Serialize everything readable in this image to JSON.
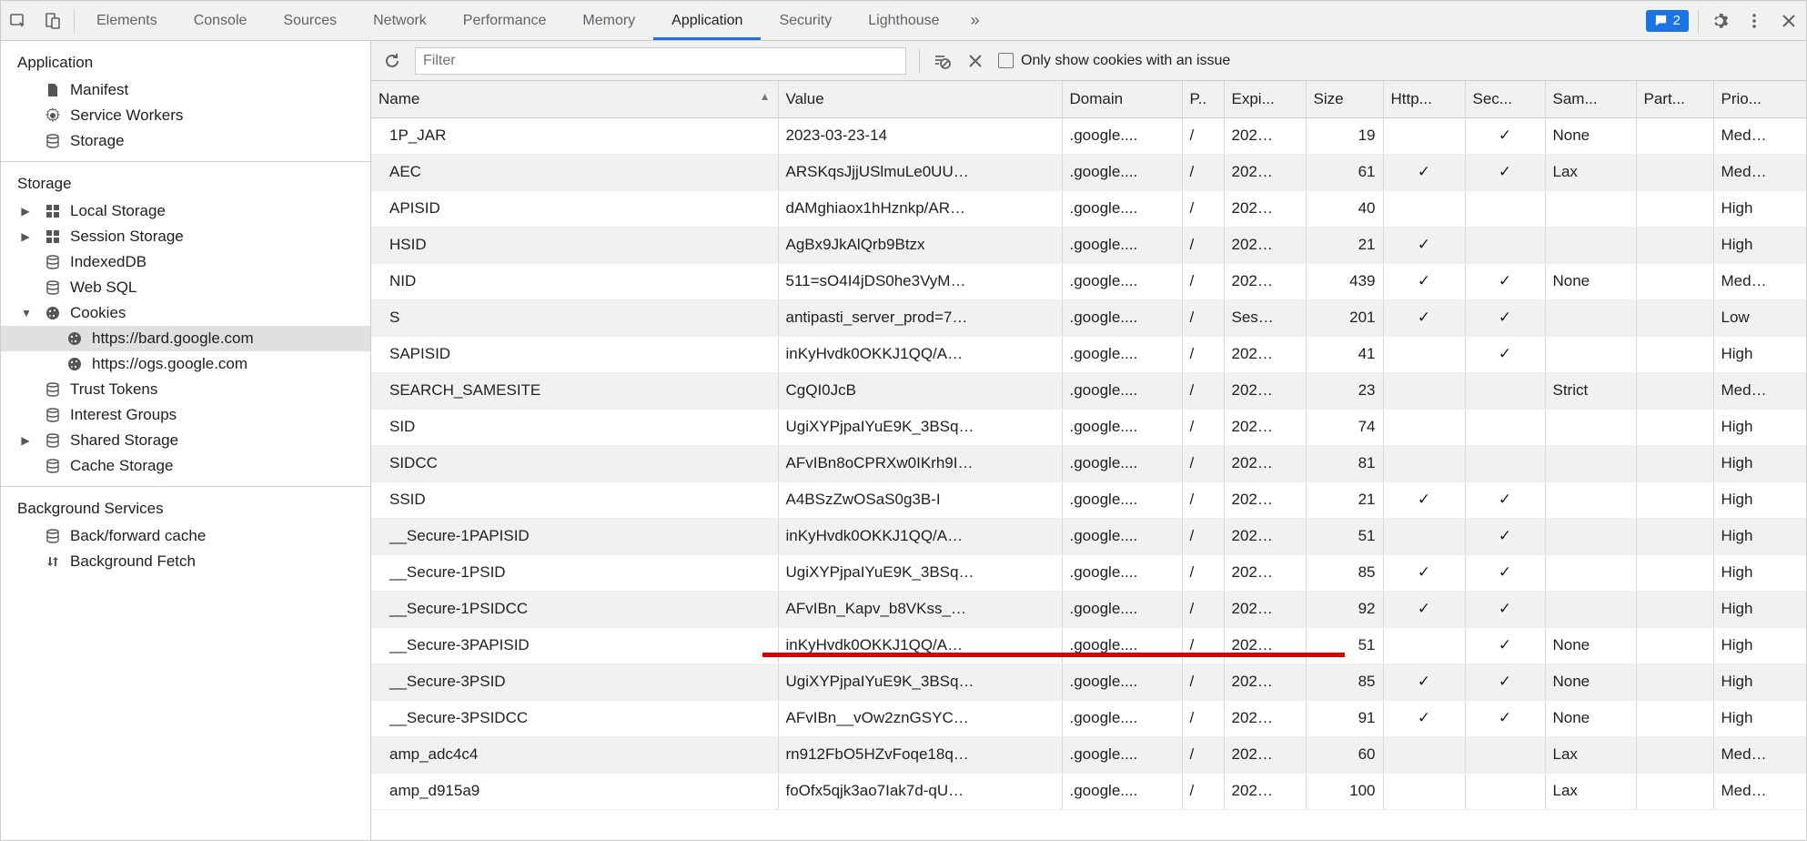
{
  "tabbar": {
    "tabs": [
      "Elements",
      "Console",
      "Sources",
      "Network",
      "Performance",
      "Memory",
      "Application",
      "Security",
      "Lighthouse"
    ],
    "active": "Application",
    "issues_count": "2"
  },
  "sidebar": {
    "section_application": {
      "title": "Application",
      "items": [
        {
          "icon": "file",
          "label": "Manifest"
        },
        {
          "icon": "gear",
          "label": "Service Workers"
        },
        {
          "icon": "db",
          "label": "Storage"
        }
      ]
    },
    "section_storage": {
      "title": "Storage",
      "items": [
        {
          "tri": "right",
          "icon": "grid",
          "label": "Local Storage"
        },
        {
          "tri": "right",
          "icon": "grid",
          "label": "Session Storage"
        },
        {
          "tri": "",
          "icon": "db",
          "label": "IndexedDB"
        },
        {
          "tri": "",
          "icon": "db",
          "label": "Web SQL"
        },
        {
          "tri": "down",
          "icon": "cookie",
          "label": "Cookies"
        },
        {
          "tri": "",
          "icon": "cookie",
          "label": "https://bard.google.com",
          "indent": 2,
          "selected": true
        },
        {
          "tri": "",
          "icon": "cookie",
          "label": "https://ogs.google.com",
          "indent": 2
        },
        {
          "tri": "",
          "icon": "db",
          "label": "Trust Tokens"
        },
        {
          "tri": "",
          "icon": "db",
          "label": "Interest Groups"
        },
        {
          "tri": "right",
          "icon": "db",
          "label": "Shared Storage"
        },
        {
          "tri": "",
          "icon": "db",
          "label": "Cache Storage"
        }
      ]
    },
    "section_bg": {
      "title": "Background Services",
      "items": [
        {
          "icon": "db",
          "label": "Back/forward cache"
        },
        {
          "icon": "swap",
          "label": "Background Fetch"
        }
      ]
    }
  },
  "toolbar": {
    "filter_placeholder": "Filter",
    "only_issues_label": "Only show cookies with an issue"
  },
  "table": {
    "headers": [
      "Name",
      "Value",
      "Domain",
      "P..",
      "Expi...",
      "Size",
      "Http...",
      "Sec...",
      "Sam...",
      "Part...",
      "Prio..."
    ],
    "sort_col": 0,
    "rows": [
      {
        "name": "1P_JAR",
        "value": "2023-03-23-14",
        "domain": ".google....",
        "path": "/",
        "expires": "202…",
        "size": "19",
        "http": "",
        "sec": "✓",
        "same": "None",
        "part": "",
        "prio": "Med…"
      },
      {
        "name": "AEC",
        "value": "ARSKqsJjjUSlmuLe0UU…",
        "domain": ".google....",
        "path": "/",
        "expires": "202…",
        "size": "61",
        "http": "✓",
        "sec": "✓",
        "same": "Lax",
        "part": "",
        "prio": "Med…"
      },
      {
        "name": "APISID",
        "value": "dAMghiaox1hHznkp/AR…",
        "domain": ".google....",
        "path": "/",
        "expires": "202…",
        "size": "40",
        "http": "",
        "sec": "",
        "same": "",
        "part": "",
        "prio": "High"
      },
      {
        "name": "HSID",
        "value": "AgBx9JkAlQrb9Btzx",
        "domain": ".google....",
        "path": "/",
        "expires": "202…",
        "size": "21",
        "http": "✓",
        "sec": "",
        "same": "",
        "part": "",
        "prio": "High"
      },
      {
        "name": "NID",
        "value": "511=sO4I4jDS0he3VyM…",
        "domain": ".google....",
        "path": "/",
        "expires": "202…",
        "size": "439",
        "http": "✓",
        "sec": "✓",
        "same": "None",
        "part": "",
        "prio": "Med…"
      },
      {
        "name": "S",
        "value": "antipasti_server_prod=7…",
        "domain": ".google....",
        "path": "/",
        "expires": "Ses…",
        "size": "201",
        "http": "✓",
        "sec": "✓",
        "same": "",
        "part": "",
        "prio": "Low"
      },
      {
        "name": "SAPISID",
        "value": "inKyHvdk0OKKJ1QQ/A…",
        "domain": ".google....",
        "path": "/",
        "expires": "202…",
        "size": "41",
        "http": "",
        "sec": "✓",
        "same": "",
        "part": "",
        "prio": "High"
      },
      {
        "name": "SEARCH_SAMESITE",
        "value": "CgQI0JcB",
        "domain": ".google....",
        "path": "/",
        "expires": "202…",
        "size": "23",
        "http": "",
        "sec": "",
        "same": "Strict",
        "part": "",
        "prio": "Med…"
      },
      {
        "name": "SID",
        "value": "UgiXYPjpaIYuE9K_3BSq…",
        "domain": ".google....",
        "path": "/",
        "expires": "202…",
        "size": "74",
        "http": "",
        "sec": "",
        "same": "",
        "part": "",
        "prio": "High"
      },
      {
        "name": "SIDCC",
        "value": "AFvIBn8oCPRXw0IKrh9I…",
        "domain": ".google....",
        "path": "/",
        "expires": "202…",
        "size": "81",
        "http": "",
        "sec": "",
        "same": "",
        "part": "",
        "prio": "High"
      },
      {
        "name": "SSID",
        "value": "A4BSzZwOSaS0g3B-I",
        "domain": ".google....",
        "path": "/",
        "expires": "202…",
        "size": "21",
        "http": "✓",
        "sec": "✓",
        "same": "",
        "part": "",
        "prio": "High"
      },
      {
        "name": "__Secure-1PAPISID",
        "value": "inKyHvdk0OKKJ1QQ/A…",
        "domain": ".google....",
        "path": "/",
        "expires": "202…",
        "size": "51",
        "http": "",
        "sec": "✓",
        "same": "",
        "part": "",
        "prio": "High"
      },
      {
        "name": "__Secure-1PSID",
        "value": "UgiXYPjpaIYuE9K_3BSq…",
        "domain": ".google....",
        "path": "/",
        "expires": "202…",
        "size": "85",
        "http": "✓",
        "sec": "✓",
        "same": "",
        "part": "",
        "prio": "High"
      },
      {
        "name": "__Secure-1PSIDCC",
        "value": "AFvIBn_Kapv_b8VKss_…",
        "domain": ".google....",
        "path": "/",
        "expires": "202…",
        "size": "92",
        "http": "✓",
        "sec": "✓",
        "same": "",
        "part": "",
        "prio": "High"
      },
      {
        "name": "__Secure-3PAPISID",
        "value": "inKyHvdk0OKKJ1QQ/A…",
        "domain": ".google....",
        "path": "/",
        "expires": "202…",
        "size": "51",
        "http": "",
        "sec": "✓",
        "same": "None",
        "part": "",
        "prio": "High"
      },
      {
        "name": "__Secure-3PSID",
        "value": "UgiXYPjpaIYuE9K_3BSq…",
        "domain": ".google....",
        "path": "/",
        "expires": "202…",
        "size": "85",
        "http": "✓",
        "sec": "✓",
        "same": "None",
        "part": "",
        "prio": "High"
      },
      {
        "name": "__Secure-3PSIDCC",
        "value": "AFvIBn__vOw2znGSYC…",
        "domain": ".google....",
        "path": "/",
        "expires": "202…",
        "size": "91",
        "http": "✓",
        "sec": "✓",
        "same": "None",
        "part": "",
        "prio": "High"
      },
      {
        "name": "amp_adc4c4",
        "value": "rn912FbO5HZvFoqe18q…",
        "domain": ".google....",
        "path": "/",
        "expires": "202…",
        "size": "60",
        "http": "",
        "sec": "",
        "same": "Lax",
        "part": "",
        "prio": "Med…"
      },
      {
        "name": "amp_d915a9",
        "value": "foOfx5qjk3ao7Iak7d-qU…",
        "domain": ".google....",
        "path": "/",
        "expires": "202…",
        "size": "100",
        "http": "",
        "sec": "",
        "same": "Lax",
        "part": "",
        "prio": "Med…"
      }
    ]
  }
}
